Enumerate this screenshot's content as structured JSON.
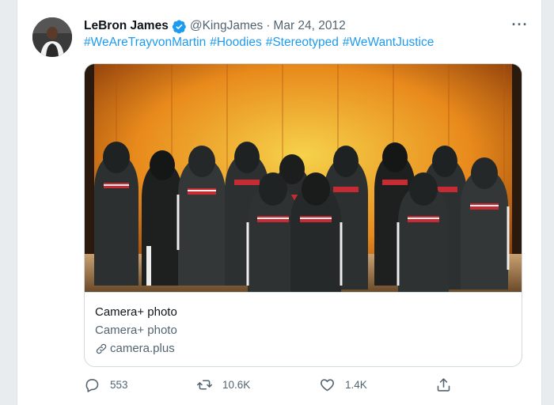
{
  "tweet": {
    "author_name": "LeBron James",
    "handle": "@KingJames",
    "separator": "·",
    "date": "Mar 24, 2012",
    "hashtags": [
      "#WeAreTrayvonMartin",
      "#Hoodies",
      "#Stereotyped",
      "#WeWantJustice"
    ]
  },
  "card": {
    "title": "Camera+ photo",
    "description": "Camera+ photo",
    "domain": "camera.plus"
  },
  "actions": {
    "replies": "553",
    "retweets": "10.6K",
    "likes": "1.4K"
  },
  "icons": {
    "verified": "verified-badge-icon",
    "more": "more-options-icon",
    "link": "link-icon",
    "reply": "reply-icon",
    "retweet": "retweet-icon",
    "like": "like-icon",
    "share": "share-icon"
  },
  "colors": {
    "accent": "#1d9bf0",
    "secondary_text": "#536471",
    "border": "#cfd9de"
  }
}
